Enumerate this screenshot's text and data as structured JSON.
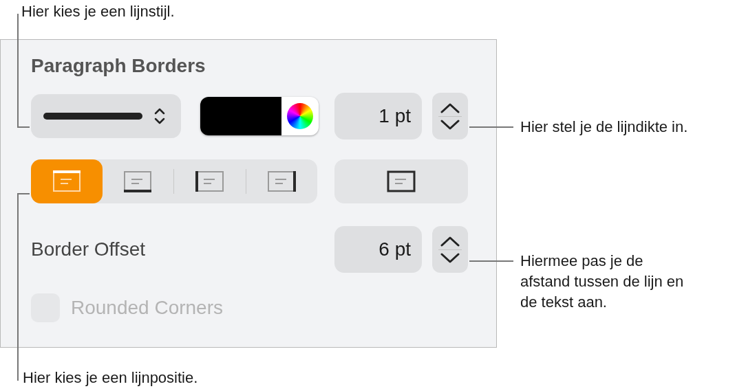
{
  "panel": {
    "title": "Paragraph Borders",
    "line_style": {
      "kind": "solid"
    },
    "color_well": {
      "color": "#000000"
    },
    "thickness": {
      "value": "1 pt"
    },
    "positions": [
      {
        "kind": "top",
        "selected": true
      },
      {
        "kind": "bottom",
        "selected": false
      },
      {
        "kind": "left",
        "selected": false
      },
      {
        "kind": "right",
        "selected": false
      }
    ],
    "outline": {
      "kind": "all",
      "selected": false
    },
    "border_offset": {
      "label": "Border Offset",
      "value": "6 pt"
    },
    "rounded_corners": {
      "label": "Rounded Corners",
      "checked": false,
      "disabled": true
    }
  },
  "callouts": [
    {
      "text": "Hier kies je een lijnstijl."
    },
    {
      "text": "Hier stel je de lijndikte in."
    },
    {
      "text": "Hiermee pas je de afstand tussen de lijn en de tekst aan."
    },
    {
      "text": "Hier kies je een lijnpositie."
    }
  ]
}
